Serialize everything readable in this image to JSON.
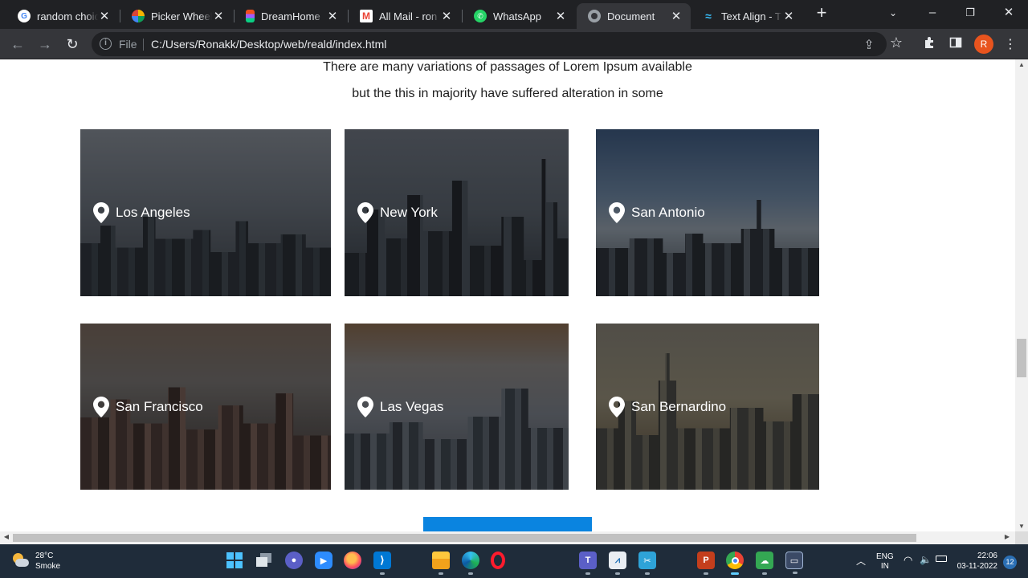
{
  "browser": {
    "tabs": [
      {
        "title": "random choic",
        "favicon": "google-icon",
        "color": "#ffffff"
      },
      {
        "title": "Picker Wheel",
        "favicon": "picker-wheel-icon",
        "color": "#f4b400"
      },
      {
        "title": "DreamHome",
        "favicon": "figma-icon",
        "color": "#f24e1e"
      },
      {
        "title": "All Mail - ron",
        "favicon": "gmail-icon",
        "color": "#ea4335"
      },
      {
        "title": "WhatsApp",
        "favicon": "whatsapp-icon",
        "color": "#25d366"
      },
      {
        "title": "Document",
        "favicon": "globe-icon",
        "color": "#9aa0a6",
        "active": true
      },
      {
        "title": "Text Align - T",
        "favicon": "tailwind-icon",
        "color": "#38bdf8"
      }
    ],
    "address": {
      "scheme": "File",
      "url": "C:/Users/Ronakk/Desktop/web/reald/index.html"
    },
    "profile_initial": "R"
  },
  "page": {
    "lines": [
      "There are many variations of passages of Lorem Ipsum available",
      "but the this in majority have suffered alteration in some"
    ],
    "locations": [
      {
        "name": "Los Angeles"
      },
      {
        "name": "New York"
      },
      {
        "name": "San Antonio"
      },
      {
        "name": "San Francisco"
      },
      {
        "name": "Las Vegas"
      },
      {
        "name": "San Bernardino"
      }
    ],
    "accent": "#0a84e0"
  },
  "taskbar": {
    "weather": {
      "temp": "28°C",
      "condition": "Smoke"
    },
    "language": {
      "lang": "ENG",
      "region": "IN"
    },
    "clock": {
      "time": "22:06",
      "date": "03-11-2022"
    },
    "notification_count": "12"
  }
}
